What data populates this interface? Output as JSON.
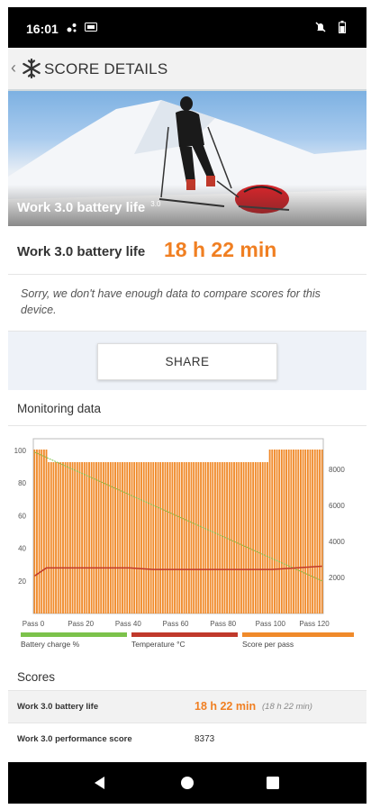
{
  "status": {
    "time": "16:01"
  },
  "header": {
    "title": "SCORE DETAILS",
    "back_icon": "chevron-left-icon",
    "logo_icon": "snowflake-icon"
  },
  "hero": {
    "caption": "Work 3.0 battery life",
    "caption_sup": "3.0"
  },
  "result": {
    "label": "Work 3.0 battery life",
    "value": "18 h 22 min"
  },
  "notice": "Sorry, we don't have enough data to compare scores for this device.",
  "share": {
    "label": "SHARE"
  },
  "monitoring": {
    "title": "Monitoring data"
  },
  "legend": [
    {
      "label": "Battery charge %",
      "color": "#7cc24b"
    },
    {
      "label": "Temperature °C",
      "color": "#c0392b"
    },
    {
      "label": "Score per pass",
      "color": "#f08a2a"
    }
  ],
  "chart_data": {
    "type": "bar",
    "left_axis": {
      "ticks": [
        "20",
        "40",
        "60",
        "80",
        "100"
      ],
      "range": [
        0,
        105
      ]
    },
    "right_axis": {
      "ticks": [
        "2000",
        "4000",
        "6000",
        "8000"
      ],
      "range": [
        0,
        9500
      ]
    },
    "x_ticks": [
      "Pass 0",
      "Pass 20",
      "Pass 40",
      "Pass 60",
      "Pass 80",
      "Pass 100",
      "Pass 120"
    ],
    "passes": 122,
    "series": [
      {
        "name": "Score per pass",
        "axis": "right",
        "type": "bar",
        "color": "#f08a2a",
        "segments": [
          {
            "from": 0,
            "to": 5,
            "value": 9100
          },
          {
            "from": 6,
            "to": 98,
            "value": 8400
          },
          {
            "from": 99,
            "to": 121,
            "value": 9100
          }
        ]
      },
      {
        "name": "Battery charge %",
        "axis": "left",
        "type": "line",
        "color": "#7cc24b",
        "points": [
          [
            0,
            99
          ],
          [
            121,
            20
          ]
        ]
      },
      {
        "name": "Temperature °C",
        "axis": "left",
        "type": "line",
        "color": "#c0392b",
        "points": [
          [
            0,
            23
          ],
          [
            5,
            28
          ],
          [
            40,
            28
          ],
          [
            50,
            27
          ],
          [
            100,
            27
          ],
          [
            110,
            28
          ],
          [
            121,
            29
          ]
        ]
      }
    ]
  },
  "scores": {
    "title": "Scores",
    "rows": [
      {
        "label": "Work 3.0 battery life",
        "value": "18 h 22 min",
        "sub": "(18 h 22 min)"
      },
      {
        "label": "Work 3.0 performance score",
        "value": "8373"
      }
    ]
  }
}
